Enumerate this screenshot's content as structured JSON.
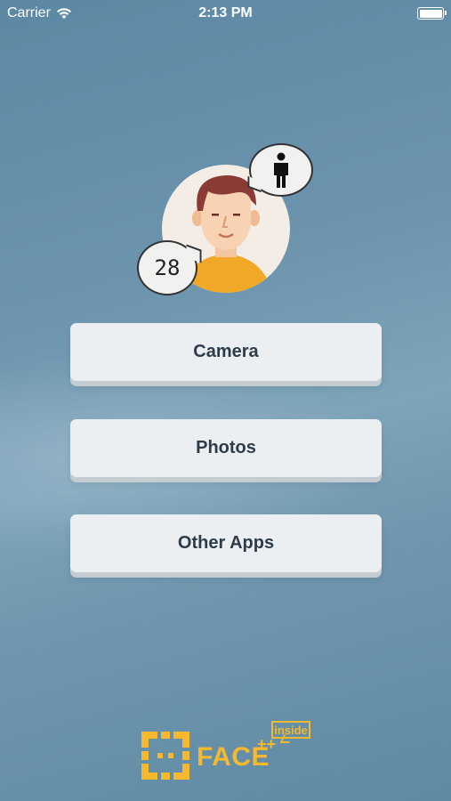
{
  "status_bar": {
    "carrier": "Carrier",
    "time": "2:13 PM",
    "battery_level": 1.0
  },
  "hero": {
    "age": "28",
    "gender_icon": "male-person-icon",
    "avatar_icon": "man-avatar-icon"
  },
  "buttons": {
    "camera": "Camera",
    "photos": "Photos",
    "other_apps": "Other Apps"
  },
  "logo": {
    "word": "FACE",
    "plus": "++",
    "tag": "inside"
  },
  "colors": {
    "background": "#6b93ab",
    "button": "#eceff1",
    "button_text": "#2e3c4a",
    "logo": "#f5b82e"
  }
}
